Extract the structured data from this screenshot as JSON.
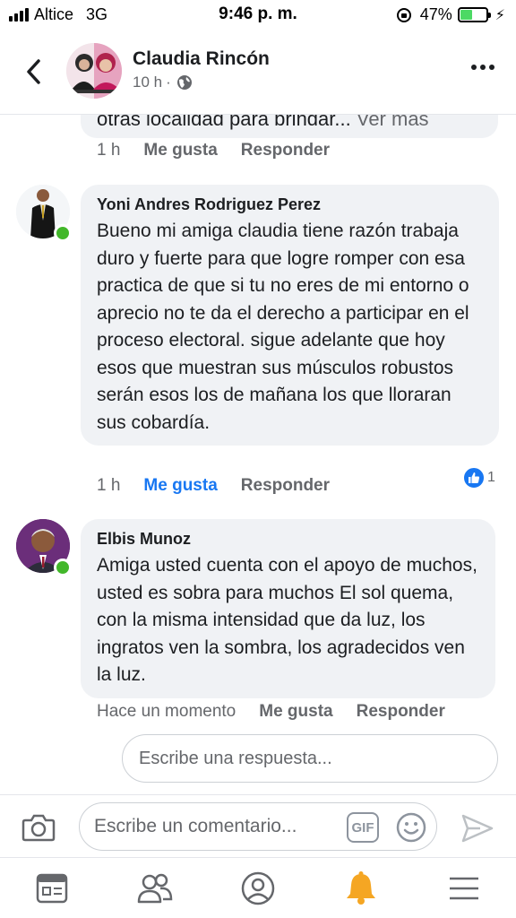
{
  "status_bar": {
    "carrier": "Altice",
    "network": "3G",
    "time": "9:46 p. m.",
    "battery_level": "47%",
    "battery_fraction": 0.47
  },
  "header": {
    "name": "Claudia Rincón",
    "time": "10 h",
    "separator": "·",
    "icons": [
      "back-arrow-icon",
      "globe-icon",
      "more-icon"
    ]
  },
  "comments": {
    "partial": {
      "text": "otras localidad para brindar...",
      "see_more": "Ver más",
      "time": "1 h",
      "like": "Me gusta",
      "reply": "Responder"
    },
    "items": [
      {
        "author": "Yoni Andres Rodriguez Perez",
        "text": "Bueno mi amiga claudia tiene razón trabaja duro y fuerte para que logre romper con esa practica de que si tu no eres de mi entorno o aprecio no te da el derecho a participar en el proceso electoral. sigue adelante que hoy esos que muestran sus músculos robustos serán esos los de mañana los que lloraran sus cobardía.",
        "time": "1 h",
        "like": "Me gusta",
        "reply": "Responder",
        "liked": true,
        "reaction_count": "1"
      },
      {
        "author": "Elbis Munoz",
        "text": "Amiga usted cuenta con el apoyo de muchos, usted es sobra para muchos El sol quema, con la misma intensidad que da luz, los ingratos ven la sombra, los agradecidos ven la luz.",
        "time": "Hace un momento",
        "like": "Me gusta",
        "reply": "Responder",
        "liked": false
      }
    ],
    "reply_placeholder": "Escribe una respuesta..."
  },
  "composer": {
    "placeholder": "Escribe un comentario...",
    "gif_label": "GIF",
    "icons": [
      "camera-icon",
      "emoji-icon",
      "send-icon"
    ]
  },
  "tabbar": {
    "tabs": [
      "news-feed-icon",
      "friends-icon",
      "profile-icon",
      "notifications-icon",
      "menu-icon"
    ],
    "active": "notifications-icon",
    "colors": {
      "notifications": "#f5a623",
      "inactive": "#65676b"
    }
  },
  "colors": {
    "accent": "#1877f2",
    "online": "#42b72a",
    "bubble": "#f0f2f5"
  }
}
